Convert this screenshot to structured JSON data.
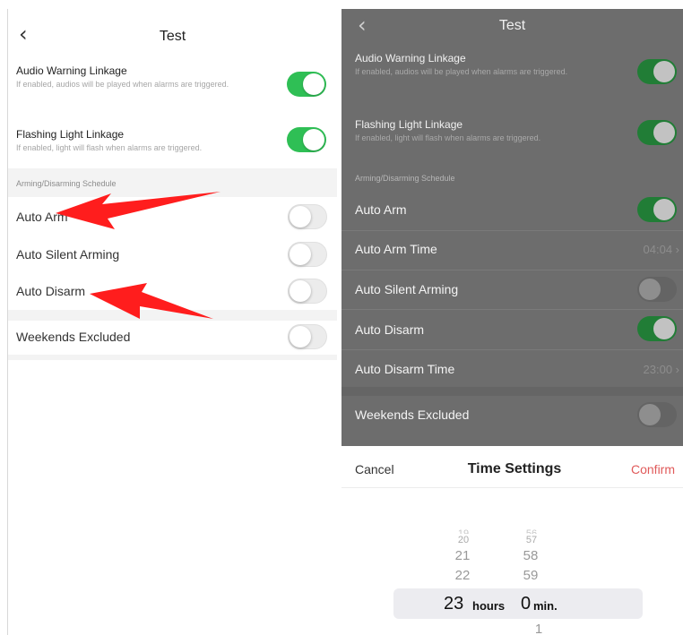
{
  "left_screen": {
    "title": "Test",
    "back_icon": "‹",
    "audio_warning": {
      "label": "Audio Warning Linkage",
      "desc": "If enabled, audios will be played when alarms are triggered.",
      "on": true
    },
    "flashing_light": {
      "label": "Flashing Light Linkage",
      "desc": "If enabled, light will flash when alarms are triggered.",
      "on": true
    },
    "section_label": "Arming/Disarming Schedule",
    "auto_arm": {
      "label": "Auto Arm",
      "on": false
    },
    "auto_silent_arming": {
      "label": "Auto Silent Arming",
      "on": false
    },
    "auto_disarm": {
      "label": "Auto Disarm",
      "on": false
    },
    "weekends_excluded": {
      "label": "Weekends Excluded",
      "on": false
    }
  },
  "right_screen": {
    "title": "Test",
    "back_icon": "‹",
    "audio_warning": {
      "label": "Audio Warning Linkage",
      "desc": "If enabled, audios will be played when alarms are triggered.",
      "on": true
    },
    "flashing_light": {
      "label": "Flashing Light Linkage",
      "desc": "If enabled, light will flash when alarms are triggered.",
      "on": true
    },
    "section_label": "Arming/Disarming Schedule",
    "auto_arm": {
      "label": "Auto Arm",
      "on": true
    },
    "auto_arm_time": {
      "label": "Auto Arm Time",
      "value": "04:04 ›"
    },
    "auto_silent_arming": {
      "label": "Auto Silent Arming",
      "on": false
    },
    "auto_disarm": {
      "label": "Auto Disarm",
      "on": true
    },
    "auto_disarm_time": {
      "label": "Auto Disarm Time",
      "value": "23:00 ›"
    },
    "weekends_excluded": {
      "label": "Weekends Excluded",
      "on": false
    }
  },
  "time_sheet": {
    "cancel": "Cancel",
    "title": "Time Settings",
    "confirm": "Confirm",
    "hours_partial": "19",
    "hours": [
      "20",
      "21",
      "22"
    ],
    "hours_selected": "23",
    "hours_unit": "hours",
    "minutes_partial": "56",
    "minutes": [
      "57",
      "58",
      "59"
    ],
    "minutes_selected": "0",
    "minutes_unit": "min.",
    "minutes_next": "1"
  },
  "colors": {
    "toggle_on": "#2fbf55",
    "confirm": "#e05a5a",
    "arrow": "#ff1d1d"
  }
}
